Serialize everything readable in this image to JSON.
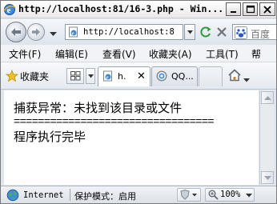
{
  "window": {
    "title": "http://localhost:81/16-3.php - Win..."
  },
  "navbar": {
    "address": "http://localhost:8",
    "search_placeholder": "百度"
  },
  "menubar": {
    "items": [
      {
        "label": "文件(F)"
      },
      {
        "label": "编辑(E)"
      },
      {
        "label": "查看(V)"
      },
      {
        "label": "收藏夹(A)"
      },
      {
        "label": "工具(T)"
      },
      {
        "label": "帮"
      }
    ]
  },
  "favorites": {
    "label": "收藏夹"
  },
  "tabs": [
    {
      "label": "h.",
      "icon": "ie-page-icon",
      "active": true
    },
    {
      "label": "QQ...",
      "icon": "qq-icon",
      "active": false
    }
  ],
  "content": {
    "lines": [
      "捕获异常：未找到该目录或文件",
      "=================================",
      "程序执行完毕"
    ]
  },
  "statusbar": {
    "zone": "Internet",
    "protected_mode": "保护模式：启用",
    "zoom": "100%"
  },
  "colors": {
    "chrome": "#dfe6ee",
    "content_bg": "#ffffff",
    "close_red": "#d33b2f"
  }
}
